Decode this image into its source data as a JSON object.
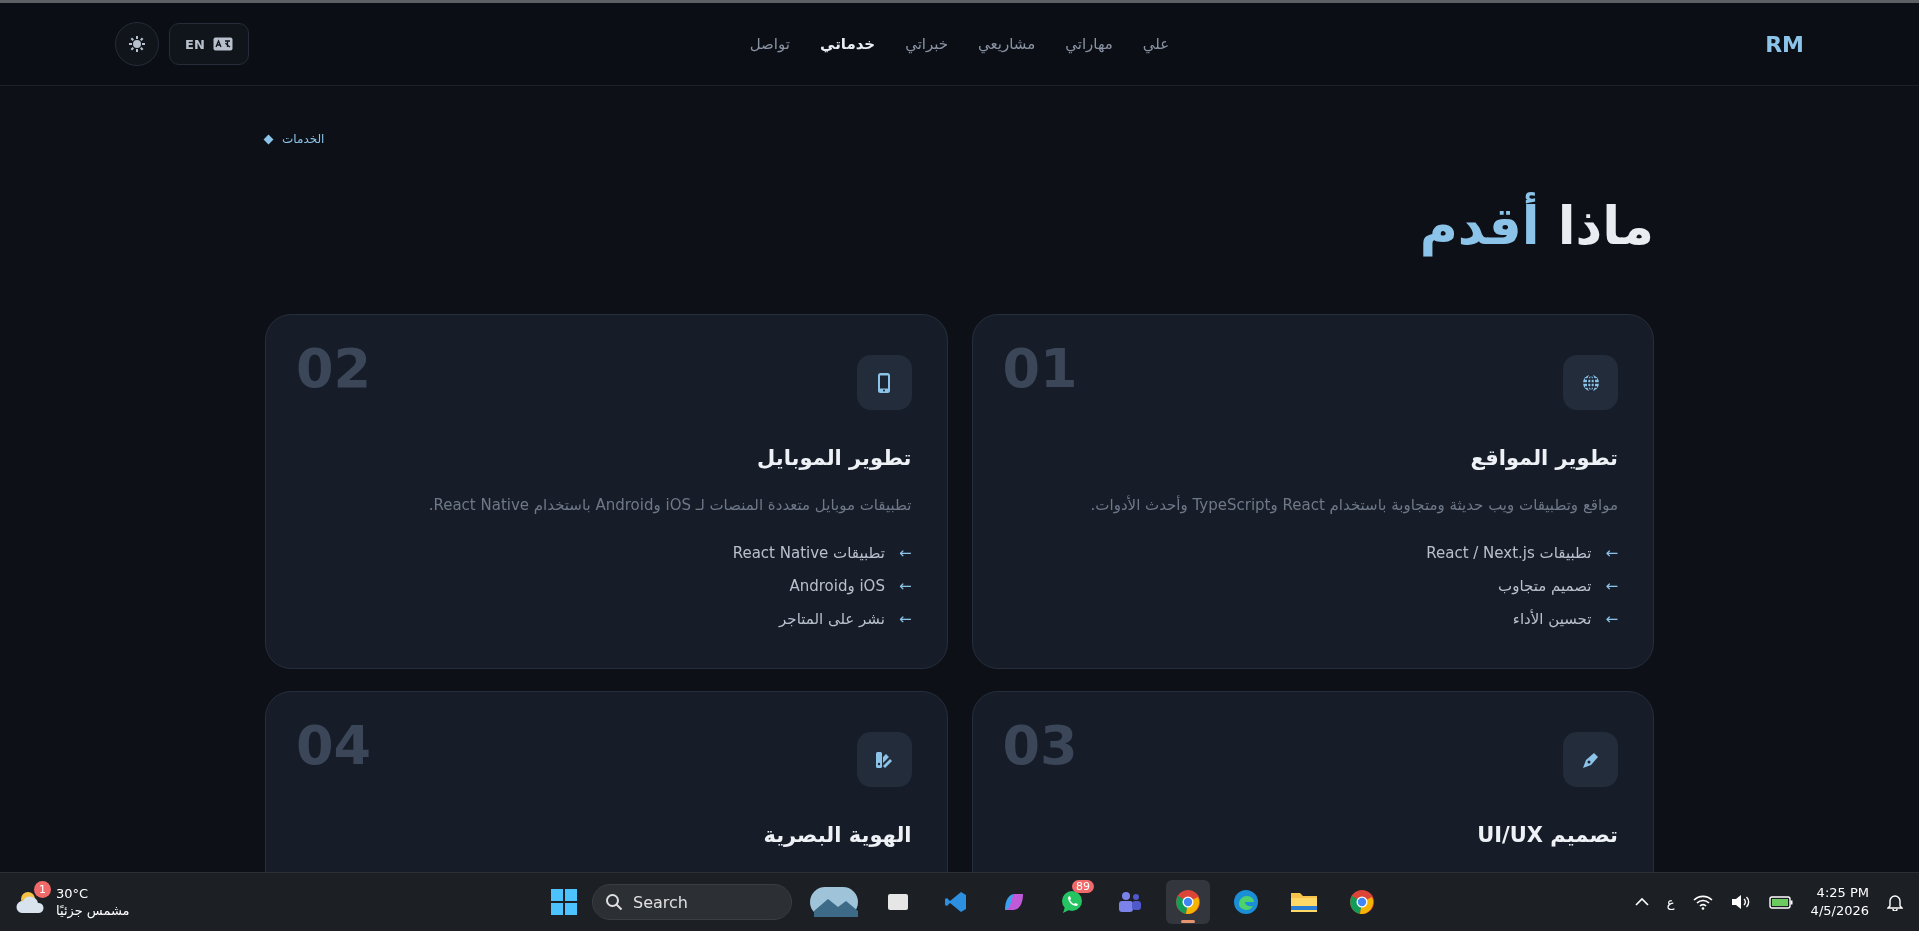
{
  "nav": {
    "logo": "RM",
    "links": [
      {
        "label": "علي",
        "selected": false
      },
      {
        "label": "مهاراتي",
        "selected": false
      },
      {
        "label": "مشاريعي",
        "selected": false
      },
      {
        "label": "خبراتي",
        "selected": false
      },
      {
        "label": "خدماتي",
        "selected": true
      },
      {
        "label": "تواصل",
        "selected": false
      }
    ],
    "language_button": "EN"
  },
  "section": {
    "breadcrumb": "الخدمات",
    "title": "ماذا",
    "title_accent": "أقدم",
    "cards": [
      {
        "number": "01",
        "kind": "globe",
        "title": "تطوير المواقع",
        "description": "مواقع وتطبيقات ويب حديثة ومتجاوبة باستخدام React وTypeScript وأحدث الأدوات.",
        "features": [
          {
            "arrow": "←",
            "text": "تطبيقات React / Next.js"
          },
          {
            "arrow": "←",
            "text": "تصميم متجاوب"
          },
          {
            "arrow": "←",
            "text": "تحسين الأداء"
          }
        ]
      },
      {
        "number": "02",
        "kind": "phone",
        "title": "تطوير الموبايل",
        "description": "تطبيقات موبايل متعددة المنصات لـ iOS وAndroid باستخدام React Native.",
        "features": [
          {
            "arrow": "←",
            "text": "تطبيقات React Native"
          },
          {
            "arrow": "←",
            "text": "iOS وAndroid"
          },
          {
            "arrow": "←",
            "text": "نشر على المتاجر"
          }
        ]
      },
      {
        "number": "03",
        "kind": "pen",
        "title": "تصميم UI/UX"
      },
      {
        "number": "04",
        "kind": "palette",
        "title": "الهوية البصرية"
      }
    ]
  },
  "taskbar": {
    "weather": {
      "badge": "1",
      "temperature": "30°C",
      "condition": "مشمس جزئيًا"
    },
    "search": {
      "placeholder": "Search"
    },
    "apps": [
      {
        "kind": "widget",
        "active": false
      },
      {
        "kind": "taskview",
        "active": false
      },
      {
        "kind": "editor",
        "active": false
      },
      {
        "kind": "copilot",
        "active": false
      },
      {
        "kind": "chat",
        "active": false,
        "badge": "89"
      },
      {
        "kind": "teams",
        "active": false
      },
      {
        "kind": "chrome",
        "active": true
      },
      {
        "kind": "edge",
        "active": false
      },
      {
        "kind": "folder",
        "active": false
      },
      {
        "kind": "chrome",
        "active": false
      }
    ],
    "language": "ع",
    "time": "4:25 PM",
    "date": "4/5/2026"
  }
}
